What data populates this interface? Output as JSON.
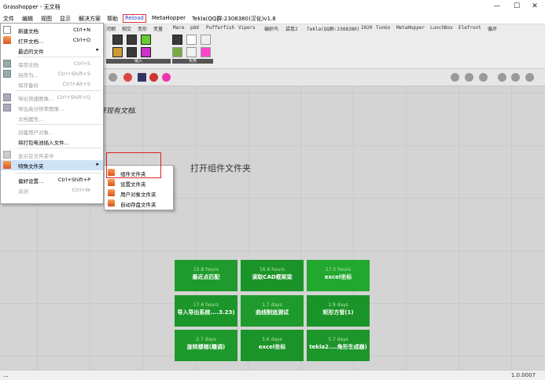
{
  "window": {
    "title": "Grasshopper - 无文档",
    "minimize": "—",
    "maximize": "☐",
    "close": "✕"
  },
  "menubar": {
    "items": [
      "文件",
      "编辑",
      "视图",
      "显示",
      "解决方案",
      "帮助"
    ],
    "reload": "Reload",
    "meta": "MetaHopper",
    "tekla": "Tekla(QQ群:2308380)汉化)v1.8",
    "plugins": [
      "河網",
      "相交",
      "变形",
      "变量",
      "Mare",
      "pOd",
      "Pufferfish",
      "Vipers",
      "编织鸟",
      "袋鼠2",
      "Tekla(QQ群:2308380)",
      "2020",
      "TunGo",
      "MetaHopper",
      "LunchBox",
      "Elefront",
      "循环"
    ]
  },
  "ribbon": {
    "groups": [
      "输入",
      "实用"
    ]
  },
  "canvas": {
    "message": "开现有文档.",
    "tooltip": "打开组件文件夹"
  },
  "file_menu": {
    "items": [
      {
        "label": "新建文档",
        "shortcut": "Ctrl+N",
        "disabled": false
      },
      {
        "label": "打开文档...",
        "shortcut": "Ctrl+O",
        "disabled": false
      },
      {
        "label": "最近的文件",
        "shortcut": "",
        "disabled": false,
        "submenu": true
      },
      {
        "label": "保存文档",
        "shortcut": "Ctrl+S",
        "disabled": true
      },
      {
        "label": "另存为...",
        "shortcut": "Ctrl+Shift+S",
        "disabled": true
      },
      {
        "label": "保存备份",
        "shortcut": "Ctrl+Alt+S",
        "disabled": true
      },
      {
        "label": "导出快速图像...",
        "shortcut": "Ctrl+Shift+Q",
        "disabled": true
      },
      {
        "label": "导出高分辨率图像...",
        "shortcut": "",
        "disabled": true
      },
      {
        "label": "文档属性...",
        "shortcut": "",
        "disabled": true
      },
      {
        "label": "创建用户对象...",
        "shortcut": "",
        "disabled": true
      },
      {
        "label": "将打包电池插入文件...",
        "shortcut": "",
        "disabled": false
      },
      {
        "label": "显示在文件夹中",
        "shortcut": "",
        "disabled": true
      },
      {
        "label": "特殊文件夹",
        "shortcut": "",
        "disabled": false,
        "submenu": true,
        "highlighted": true
      },
      {
        "label": "偏好设置...",
        "shortcut": "Ctrl+Shift+P",
        "disabled": false
      },
      {
        "label": "关闭",
        "shortcut": "Ctrl+W",
        "disabled": true
      }
    ]
  },
  "special_folders": {
    "items": [
      "组件文件夹",
      "设置文件夹",
      "用户对象文件夹",
      "自动存盘文件夹"
    ]
  },
  "recent_tiles": [
    {
      "time": "15.8 hours",
      "name": "最近点匹配",
      "color": "#1e9b2c"
    },
    {
      "time": "16.6 hours",
      "name": "读取CAD框架梁",
      "color": "#1a9428"
    },
    {
      "time": "17.5 hours",
      "name": "excel坐标",
      "color": "#22a82f"
    },
    {
      "time": "17.6 hours",
      "name": "导入导出系统....3.23)",
      "color": "#1c962a"
    },
    {
      "time": "1.7 days",
      "name": "曲线制追测试",
      "color": "#1e9b2c"
    },
    {
      "time": "1.9 days",
      "name": "矩形方管(1)",
      "color": "#1a9428"
    },
    {
      "time": "2.7 days",
      "name": "旋转楼梯(雕调)",
      "color": "#1d9a2b"
    },
    {
      "time": "5.6 days",
      "name": "excel坐标",
      "color": "#1a9428"
    },
    {
      "time": "5.7 days",
      "name": "tekla2....角形生成器)",
      "color": "#1c962a"
    }
  ],
  "status": {
    "left": "...",
    "version": "1.0.0007"
  }
}
